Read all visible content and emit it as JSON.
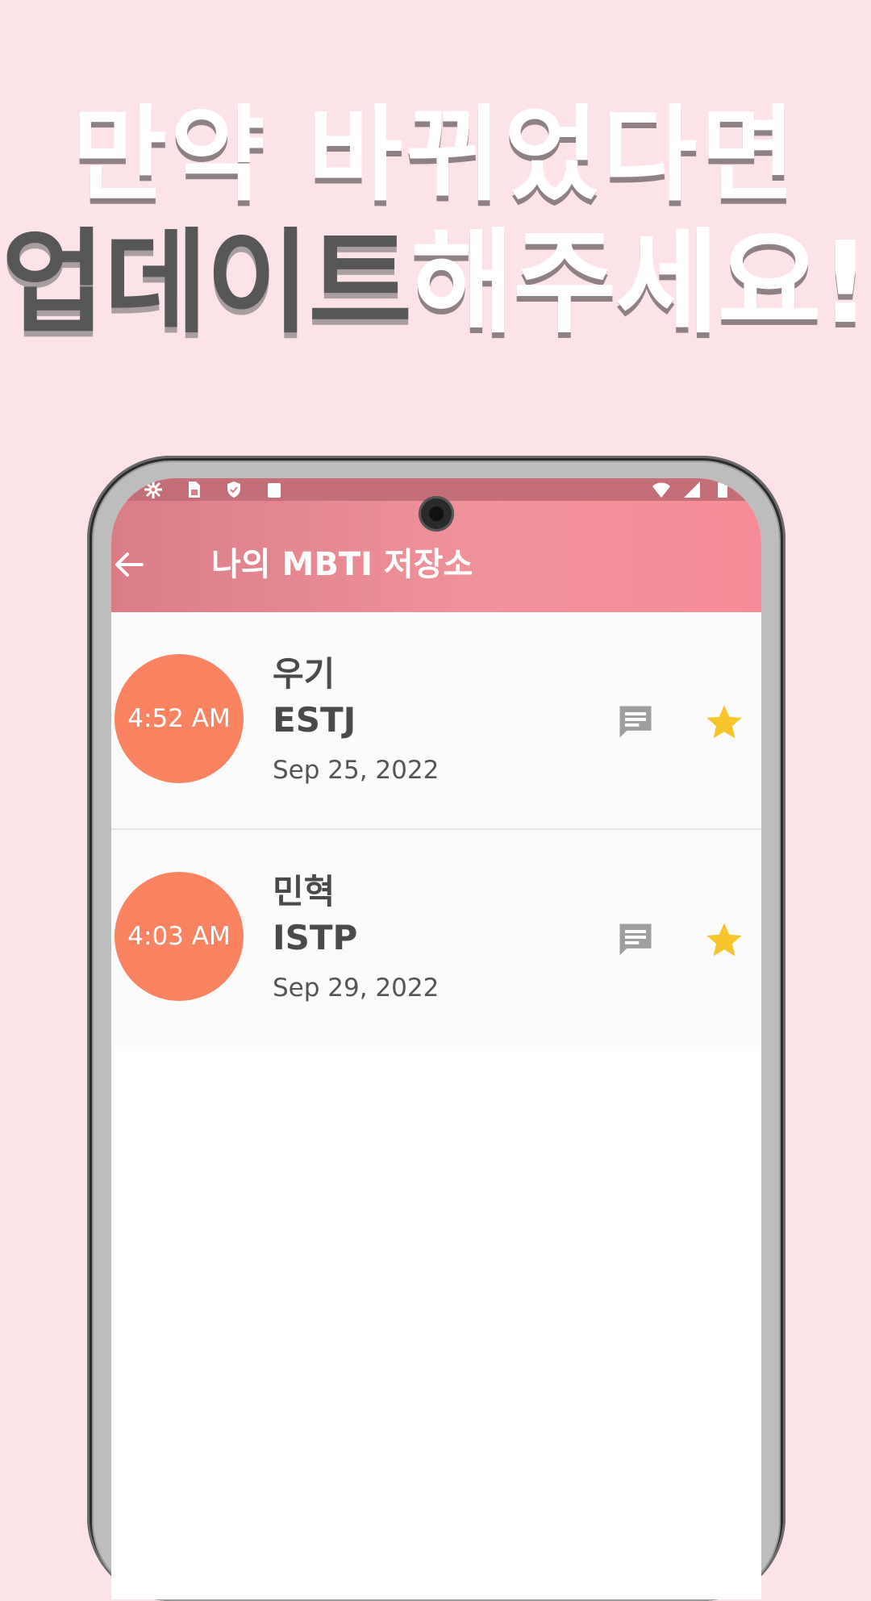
{
  "promo": {
    "line1": "만약 바뀌었다면",
    "line2_highlight": "업데이트",
    "line2_rest": "해주세요!"
  },
  "appbar": {
    "title": "나의 MBTI 저장소",
    "back_icon": "arrow-left-icon"
  },
  "list": {
    "items": [
      {
        "time": "4:52 AM",
        "name": "우기",
        "mbti": "ESTJ",
        "date": "Sep 25, 2022",
        "comment_icon": "comment-icon",
        "star_icon": "star-icon"
      },
      {
        "time": "4:03 AM",
        "name": "민혁",
        "mbti": "ISTP",
        "date": "Sep 29, 2022",
        "comment_icon": "comment-icon",
        "star_icon": "star-icon"
      }
    ]
  },
  "colors": {
    "background": "#fde3e8",
    "appbar": "#f1929a",
    "badge": "#f98361",
    "star": "#f7c42b",
    "comment_icon": "#9e9e9e"
  }
}
